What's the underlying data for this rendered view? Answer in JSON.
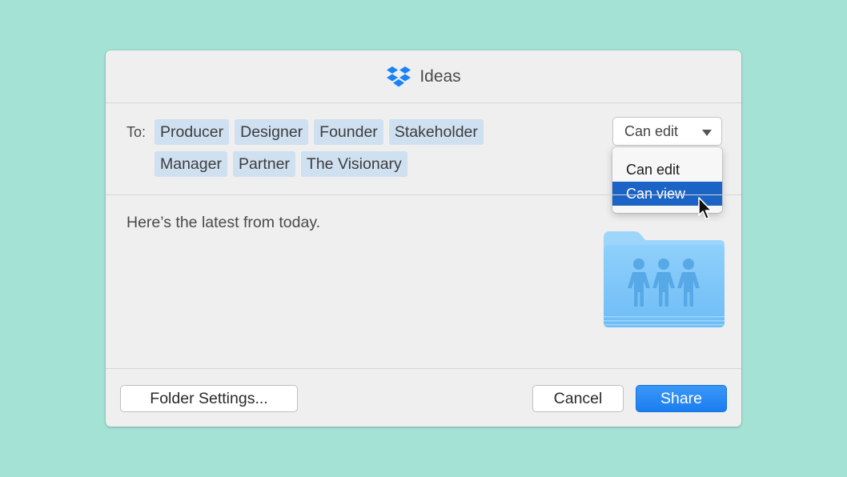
{
  "dialog": {
    "title": "Ideas",
    "logo_icon": "dropbox-logo-icon",
    "brand_color": "#1a82f7"
  },
  "recipients": {
    "label": "To:",
    "rows": [
      [
        "Producer",
        "Designer",
        "Founder",
        "Stakeholder"
      ],
      [
        "Manager",
        "Partner",
        "The Visionary"
      ]
    ]
  },
  "permission": {
    "current": "Can edit",
    "options": [
      {
        "label": "Can edit",
        "highlighted": false
      },
      {
        "label": "Can view",
        "highlighted": true
      }
    ],
    "highlight_color": "#1b63c4"
  },
  "message": {
    "text": "Here’s the latest from today."
  },
  "attachment": {
    "icon": "shared-folder-icon",
    "color": "#7cc4f8"
  },
  "footer": {
    "folder_settings_label": "Folder Settings...",
    "cancel_label": "Cancel",
    "share_label": "Share",
    "share_color": "#2288f5"
  },
  "background_color": "#a3e2d5"
}
